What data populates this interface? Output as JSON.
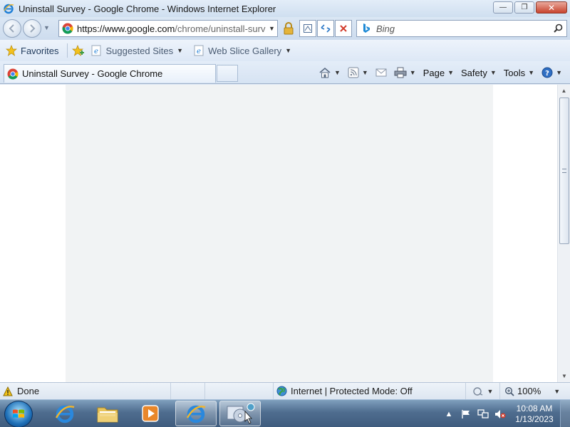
{
  "window": {
    "title": "Uninstall Survey - Google Chrome - Windows Internet Explorer",
    "controls": {
      "minimize": "—",
      "maximize": "❐",
      "close": "✕"
    }
  },
  "address_bar": {
    "url_host": "https://www.google.com",
    "url_path": "/chrome/uninstall-survey"
  },
  "search": {
    "placeholder": "Bing"
  },
  "favorites_bar": {
    "favorites_label": "Favorites",
    "suggested_sites_label": "Suggested Sites",
    "web_slice_gallery_label": "Web Slice Gallery"
  },
  "tab": {
    "label": "Uninstall Survey - Google Chrome"
  },
  "command_bar": {
    "page_label": "Page",
    "safety_label": "Safety",
    "tools_label": "Tools"
  },
  "status_bar": {
    "status_text": "Done",
    "zone_text": "Internet | Protected Mode: Off",
    "zoom_text": "100%"
  },
  "taskbar": {
    "time": "10:08 AM",
    "date": "1/13/2023"
  },
  "colors": {
    "content_panel": "#f1f3f4",
    "chrome_blue": "#dfe9f5"
  }
}
